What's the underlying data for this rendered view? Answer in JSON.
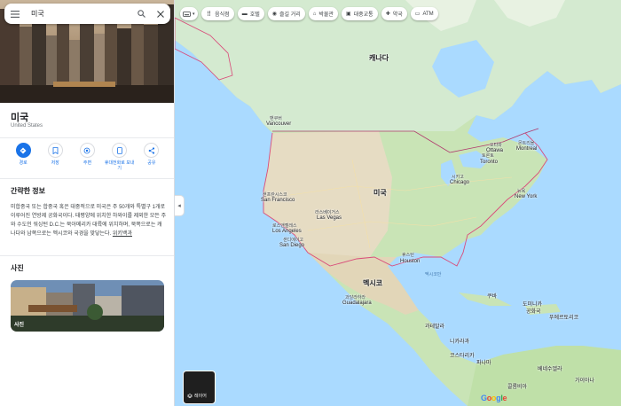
{
  "search": {
    "query": "미국"
  },
  "place": {
    "title": "미국",
    "subtitle": "United States"
  },
  "actions": [
    {
      "label": "경로"
    },
    {
      "label": "저장"
    },
    {
      "label": "주변"
    },
    {
      "label": "휴대전화로 보내기"
    },
    {
      "label": "공유"
    }
  ],
  "summary": {
    "heading": "간략한 정보",
    "text": "미합중국 또는 합중국 혹은 대중적으로 미국은 주 50개와 특별구 1개로 이루어진 연방제 공화국이다. 태평양에 위치한 하와이를 제외한 모든 주와 수도인 워싱턴 D.C.는 북아메리카 대륙에 위치하며, 북쪽으로는 캐나다와 남쪽으로는 멕시코와 국경을 맞닿는다.",
    "source": "위키백과"
  },
  "photos": {
    "heading": "사진",
    "label": "사진"
  },
  "chips": [
    {
      "icon": "restaurant-icon",
      "label": "음식점"
    },
    {
      "icon": "hotel-icon",
      "label": "호텔"
    },
    {
      "icon": "attraction-icon",
      "label": "즐길 거리"
    },
    {
      "icon": "museum-icon",
      "label": "박물관"
    },
    {
      "icon": "transit-icon",
      "label": "대중교통"
    },
    {
      "icon": "pharmacy-icon",
      "label": "약국"
    },
    {
      "icon": "atm-icon",
      "label": "ATM"
    }
  ],
  "layer": {
    "label": "레이어"
  },
  "map_labels": {
    "canada": "캐나다",
    "usa": "미국",
    "mexico": "멕시코",
    "vancouver_ko": "밴쿠버",
    "vancouver": "Vancouver",
    "sanfrancisco_ko": "샌프란시스코",
    "sanfrancisco": "San Francisco",
    "losangeles_ko": "로스앤젤레스",
    "losangeles": "Los Angeles",
    "sandiego_ko": "샌디에이고",
    "sandiego": "San Diego",
    "lasvegas_ko": "라스베이거스",
    "lasvegas": "Las Vegas",
    "chicago_ko": "시카고",
    "chicago": "Chicago",
    "toronto_ko": "토론토",
    "toronto": "Toronto",
    "ottawa_ko": "오타와",
    "ottawa": "Ottawa",
    "montreal_ko": "몬트리올",
    "montreal": "Montreal",
    "newyork_ko": "뉴욕",
    "newyork": "New York",
    "houston_ko": "휴스턴",
    "houston": "Houston",
    "guadalajara_ko": "과달라하라",
    "guadalajara": "Guadalajara",
    "guatemala": "과테말라",
    "nicaragua": "니카라과",
    "costarica": "코스타리카",
    "panama": "파나마",
    "cuba": "쿠바",
    "dominican": "도미니카",
    "dominican2": "공화국",
    "puertorico": "푸에르토리코",
    "venezuela": "베네수엘라",
    "guyana": "가이아나",
    "colombia": "콜롬비아",
    "gulf": "멕시코만"
  }
}
